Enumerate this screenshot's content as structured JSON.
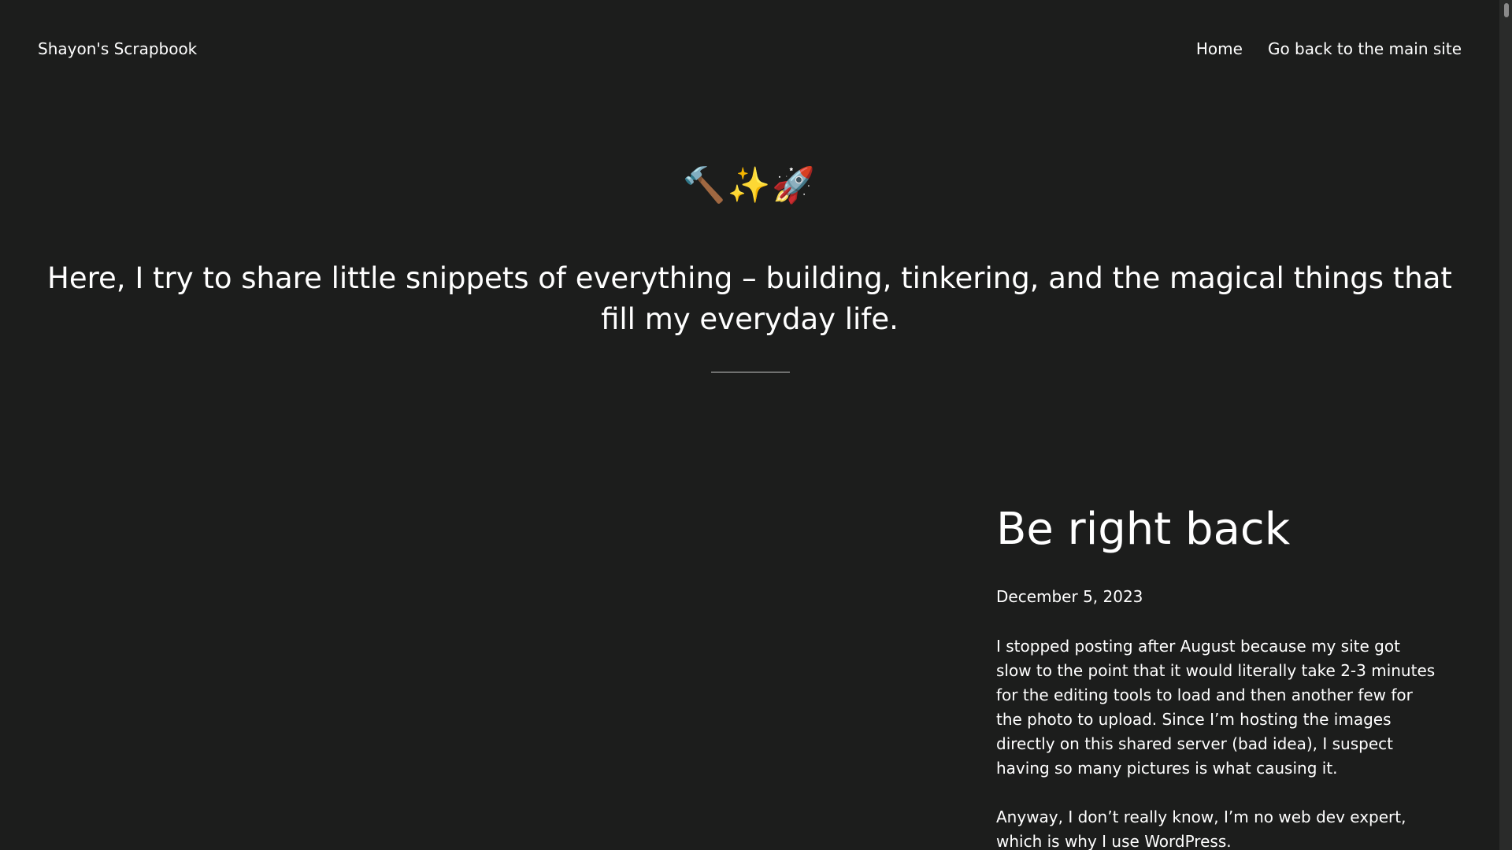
{
  "header": {
    "site_title": "Shayon's Scrapbook",
    "nav": [
      {
        "label": "Home"
      },
      {
        "label": "Go back to the main site"
      }
    ]
  },
  "hero": {
    "emojis": [
      {
        "glyph": "🔨",
        "icon": "hammer-icon"
      },
      {
        "glyph": "✨",
        "icon": "sparkles-icon"
      },
      {
        "glyph": "🚀",
        "icon": "rocket-icon"
      }
    ],
    "tagline": "Here, I try to share little snippets of everything – building, tinkering, and the magical things that fill my everyday life."
  },
  "post": {
    "title": "Be right back",
    "date": "December 5, 2023",
    "paragraphs": [
      "I stopped posting after August because my site got slow to the point that it would literally take 2-3 minutes for the editing tools to load and then another few for the photo to upload. Since I’m hosting the images directly on this shared server (bad idea), I suspect having so many pictures is what causing it.",
      "Anyway, I don’t really know, I’m no web dev expert, which is why I use WordPress."
    ]
  },
  "colors": {
    "background": "#1c1d1c",
    "text": "#ffffff",
    "divider": "#6f706f"
  }
}
